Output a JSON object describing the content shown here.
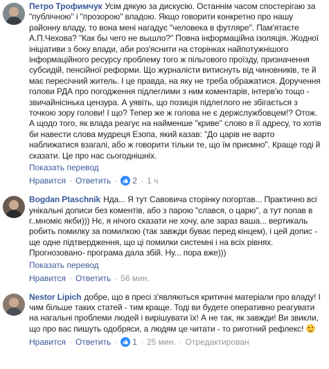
{
  "comments": [
    {
      "author": "Петро Трофимчук",
      "lines": [
        "Усім дякую за дискусію. Останнім часом спостерігаю за",
        "\"публічною\" і \"прозорою\" владою. Якщо говорити конкретно про нашу",
        "районну владу, то вона мені нагадує \"человека в футляре\". Пам'ятаєте",
        "А.П.Чехова? \"Как бы чего не вышло?\" Повна інформаційна ізоляція. Жодної",
        "ініціативи з боку влади, аби роз'яснити на сторінках найпотужнішого",
        "інформаційного ресурсу проблему того ж пільгового проїзду, призначення",
        "субсидій, пенсійної реформи. Що журналісти витиснуть від чиновників, те й",
        "має пересічний житель. І це правда, на яку не треба ображатися. Доручення",
        "голови РДА про погодження підлеглими з ним коментарів, інтерв'ю тощо -",
        "звичайнісінька цензура. А уявіть, що позиція підлеглого не збігається з",
        "точкою зору голови! І що? Тепер же ж голова не є держслужбовцем!? Отож.",
        "А щодо того, як влада реагує на найменше \"криве\" слово в її адресу, то хотів",
        "би навести слова мудреця Езопа, який казав: \"До царів не варто",
        "наближатися взагалі, або ж говорити тільки те, що їм приємно\". Краще годі й",
        "сказати. Це про нас сьогоднішніх."
      ],
      "translate": "Показать перевод",
      "like": "Нравится",
      "reply": "Ответить",
      "reactions": "2",
      "time": "1 ч"
    },
    {
      "author": "Bogdan Ptaschnik",
      "lines": [
        "Нда... Я тут Савовича сторінку погортав... Практично всі",
        "унікальні дописи без коментів, або з парою \"слався, о царю\", а тут попав в",
        "г..мноміє якби))) Нє, я нічого сказати не хочу, але зараз ваша... вертикаль",
        "робить помилку за помилкою (так завжди буває перед кінцем), і цей допис -",
        "ще одне підтвердження, що ці помилки системні і на всіх рівнях.",
        "Прогнозовано- програма дала збій. Ну... пора вже)))"
      ],
      "translate": "Показать перевод",
      "like": "Нравится",
      "reply": "Ответить",
      "time": "56 мин."
    },
    {
      "author": "Nestor Lipich",
      "lines": [
        "добре, що в пресі з'являються критичні матеріали про владу!",
        "І чим більше таких статей - тим краще. Тоді ви будете оперативно реагувати",
        "на нагальні проблеми людей і вирішувати їх! А не так, як завжди! Ви звикли,",
        "що про вас пишуть одобряси, а людям це читати - то риготний рефлекс!"
      ],
      "like": "Нравится",
      "reply": "Ответить",
      "reactions": "1",
      "time": "25 мин.",
      "edited": "Отредактирован"
    }
  ]
}
